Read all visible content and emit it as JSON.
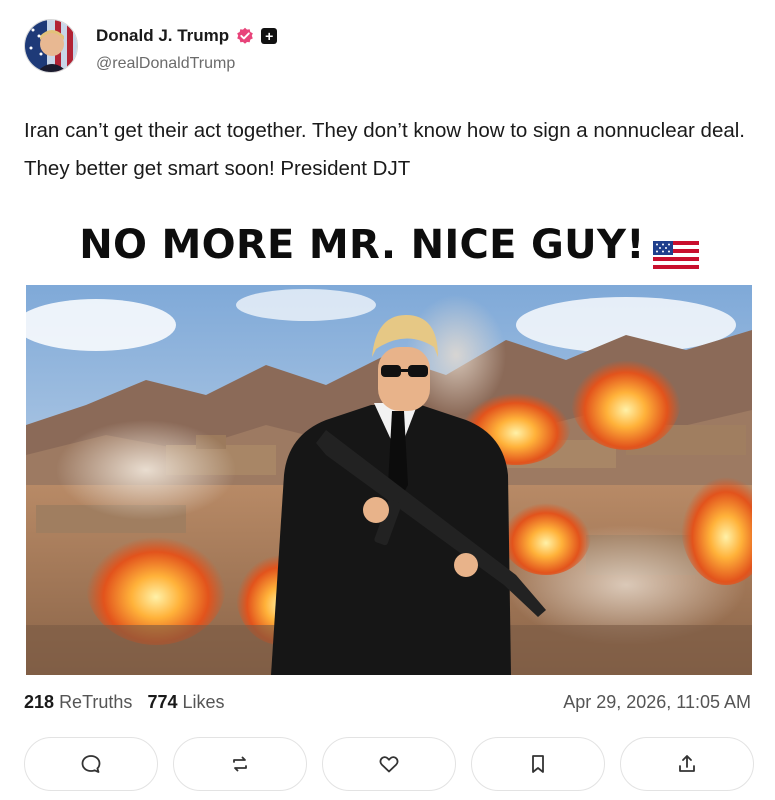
{
  "author": {
    "display_name": "Donald J. Trump",
    "handle": "@realDonaldTrump",
    "verified_icon": "verified-badge-icon",
    "extra_icon": "plus-badge-icon"
  },
  "post": {
    "text": "Iran can’t get their act together. They don’t know how to sign a nonnuclear deal. They better get smart soon! President DJT"
  },
  "media": {
    "headline": "NO MORE MR. NICE GUY!",
    "flag_icon": "us-flag-icon"
  },
  "stats": {
    "retruths_count": "218",
    "retruths_label": "ReTruths",
    "likes_count": "774",
    "likes_label": "Likes",
    "timestamp": "Apr 29, 2026, 11:05 AM"
  },
  "actions": [
    "reply-icon",
    "retruth-icon",
    "like-icon",
    "bookmark-icon",
    "share-icon"
  ],
  "colors": {
    "verified_badge": "#e8447a",
    "text": "#1a1a1a",
    "muted": "#6b6b6b",
    "border": "#e3e3e3"
  }
}
